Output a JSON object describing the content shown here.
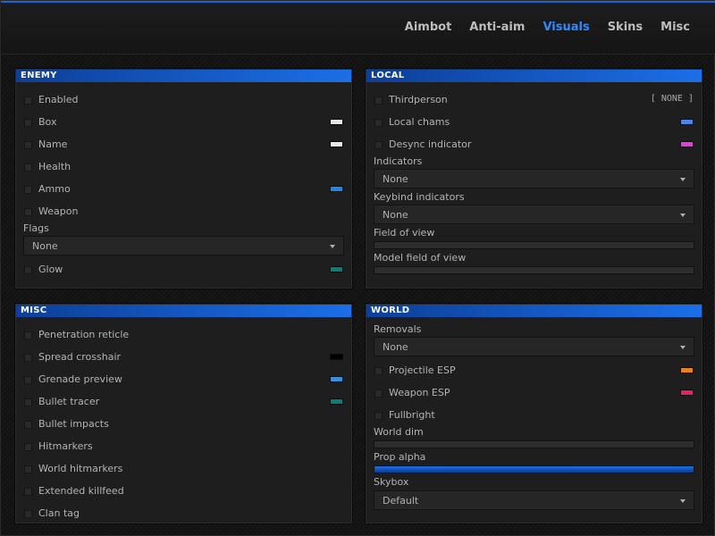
{
  "tabs": [
    {
      "label": "Aimbot",
      "active": false
    },
    {
      "label": "Anti-aim",
      "active": false
    },
    {
      "label": "Visuals",
      "active": true
    },
    {
      "label": "Skins",
      "active": false
    },
    {
      "label": "Misc",
      "active": false
    }
  ],
  "enemy": {
    "title": "ENEMY",
    "enabled": "Enabled",
    "box": "Box",
    "box_color": "#e8e8e8",
    "name": "Name",
    "name_color": "#e8e8e8",
    "health": "Health",
    "ammo": "Ammo",
    "ammo_color": "#1b88e8",
    "weapon": "Weapon",
    "flags_label": "Flags",
    "flags_value": "None",
    "glow": "Glow",
    "glow_color": "#0f7a76"
  },
  "local": {
    "title": "LOCAL",
    "thirdperson": "Thirdperson",
    "thirdperson_key": "[ NONE ]",
    "local_chams": "Local chams",
    "local_chams_color": "#4a86e8",
    "desync_indicator": "Desync indicator",
    "desync_color": "#e040d8",
    "indicators_label": "Indicators",
    "indicators_value": "None",
    "keybind_indicators_label": "Keybind indicators",
    "keybind_indicators_value": "None",
    "fov_label": "Field of view",
    "fov_value": 0,
    "model_fov_label": "Model field of view",
    "model_fov_value": 0
  },
  "misc": {
    "title": "MISC",
    "items": [
      {
        "label": "Penetration reticle",
        "color": null
      },
      {
        "label": "Spread crosshair",
        "color": "#000000"
      },
      {
        "label": "Grenade preview",
        "color": "#3a8fdc"
      },
      {
        "label": "Bullet tracer",
        "color": "#0f7a76"
      },
      {
        "label": "Bullet impacts",
        "color": null
      },
      {
        "label": "Hitmarkers",
        "color": null
      },
      {
        "label": "World hitmarkers",
        "color": null
      },
      {
        "label": "Extended killfeed",
        "color": null
      },
      {
        "label": "Clan tag",
        "color": null
      }
    ]
  },
  "world": {
    "title": "WORLD",
    "removals_label": "Removals",
    "removals_value": "None",
    "projectile_esp": "Projectile ESP",
    "projectile_color": "#e8821e",
    "weapon_esp": "Weapon ESP",
    "weapon_color": "#e0245e",
    "fullbright": "Fullbright",
    "world_dim_label": "World dim",
    "world_dim_value": 0,
    "prop_alpha_label": "Prop alpha",
    "prop_alpha_value": 100,
    "skybox_label": "Skybox",
    "skybox_value": "Default"
  }
}
